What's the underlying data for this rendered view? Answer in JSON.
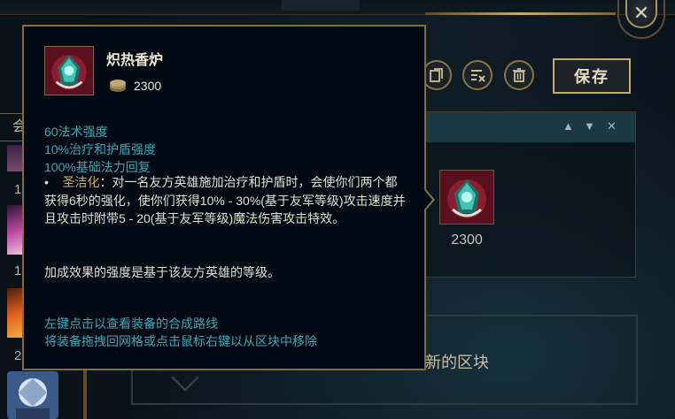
{
  "header": {
    "close_label": "✕"
  },
  "toolbar": {
    "buttons": [
      {
        "name": "duplicate-block-icon"
      },
      {
        "name": "clear-block-icon"
      },
      {
        "name": "delete-block-icon"
      }
    ],
    "save_label": "保存"
  },
  "left_panel": {
    "filter_text": "会",
    "item_counts": [
      "1",
      "1",
      "2"
    ]
  },
  "block": {
    "controls": [
      "▲",
      "▼",
      "✕"
    ],
    "items": [
      {
        "name": "炽热香炉",
        "cost": "2300"
      }
    ]
  },
  "new_block": {
    "label": "新的区块"
  },
  "tooltip": {
    "item_name": "炽热香炉",
    "cost": "2300",
    "stats": [
      "60法术强度",
      "10%治疗和护盾强度",
      "100%基础法力回复"
    ],
    "passive_bullet": "•",
    "passive_name": "圣洁化",
    "passive_text": "：对一名友方英雄施加治疗和护盾时，会使你们两个都获得6秒的强化，使你们获得10% - 30%(基于友军等级)攻击速度并且攻击时附带5 - 20(基于友军等级)魔法伤害攻击特效。",
    "note": "加成效果的强度是基于该友方英雄的等级。",
    "hints": [
      "左键点击以查看装备的合成路线",
      "将装备拖拽回网格或点击鼠标右键以从区块中移除"
    ]
  },
  "colors": {
    "gold_border": "#c8aa6e",
    "stat_teal": "#3ea8b6",
    "passive_gold": "#d4b25a",
    "tooltip_bg": "#010a13"
  }
}
